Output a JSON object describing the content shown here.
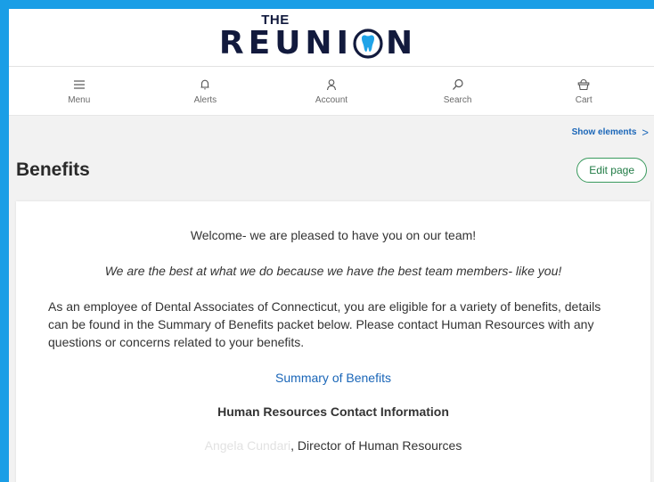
{
  "logo": {
    "top_text": "THE",
    "word_left": "REUNI",
    "word_right": "N",
    "tooth_icon": "tooth-icon"
  },
  "nav": {
    "items": [
      {
        "label": "Menu",
        "icon": "hamburger-icon"
      },
      {
        "label": "Alerts",
        "icon": "bell-icon"
      },
      {
        "label": "Account",
        "icon": "person-icon"
      },
      {
        "label": "Search",
        "icon": "search-icon"
      },
      {
        "label": "Cart",
        "icon": "basket-icon"
      }
    ]
  },
  "show_elements": {
    "label": "Show elements",
    "chevron": ">"
  },
  "page": {
    "title": "Benefits",
    "edit_label": "Edit page"
  },
  "content": {
    "welcome": "Welcome- we are pleased to have you on our team!",
    "tagline": "We are the best at what we do because we have the best team members- like you!",
    "body": "As an employee of Dental Associates of Connecticut, you are eligible for a variety of benefits, details can be found in the Summary of Benefits packet below. Please contact Human Resources with any questions or concerns related to your benefits.",
    "summary_link": "Summary of Benefits",
    "hr_heading": "Human Resources Contact Information",
    "contact_name": "Angela Cundari",
    "contact_role": ", Director of Human Resources"
  },
  "colors": {
    "outer_frame": "#1a9ee6",
    "logo_navy": "#121a3d",
    "tooth_blue": "#1fa3e8",
    "link_blue": "#1a66b8",
    "edit_green": "#1f7a44"
  }
}
